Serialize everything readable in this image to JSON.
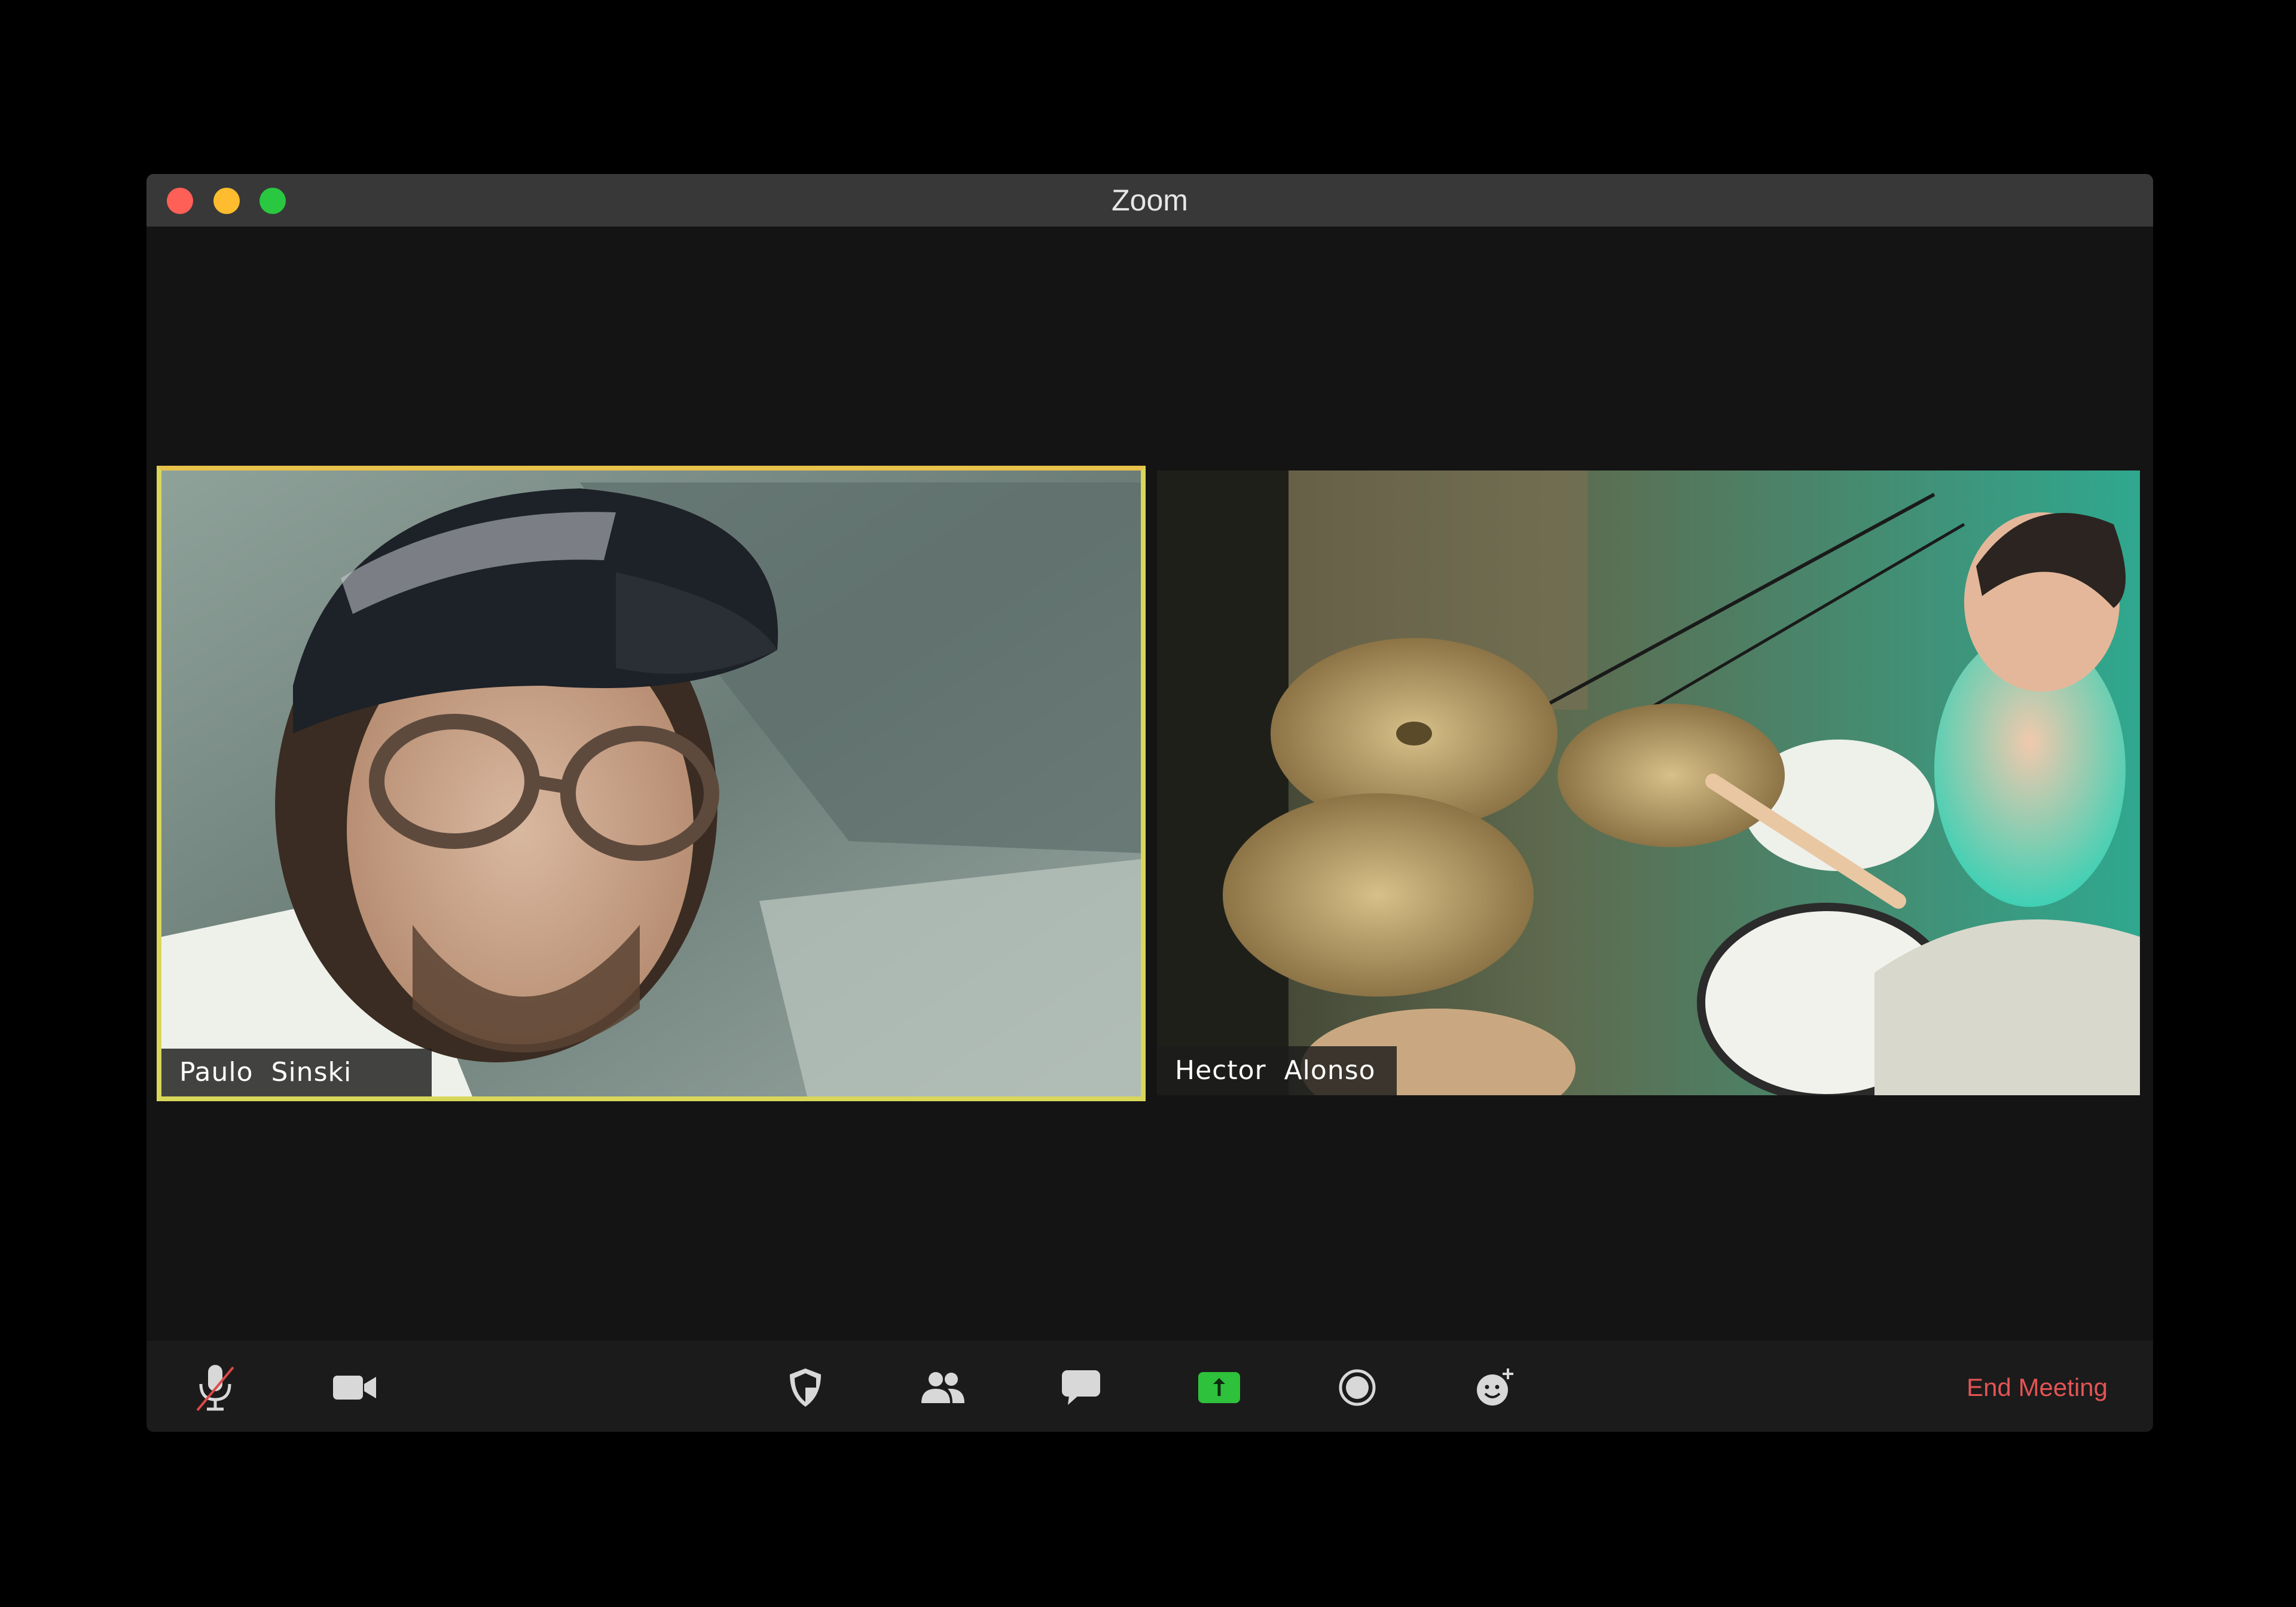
{
  "window": {
    "title": "Zoom"
  },
  "participants": [
    {
      "name": "Paulo  Sinski",
      "active_speaker": true
    },
    {
      "name": "Hector  Alonso",
      "active_speaker": false
    }
  ],
  "toolbar": {
    "buttons": [
      {
        "icon": "microphone-muted-icon",
        "label": ""
      },
      {
        "icon": "video-camera-icon",
        "label": ""
      },
      {
        "icon": "security-shield-icon",
        "label": ""
      },
      {
        "icon": "participants-icon",
        "label": ""
      },
      {
        "icon": "chat-icon",
        "label": ""
      },
      {
        "icon": "share-screen-icon",
        "label": ""
      },
      {
        "icon": "record-icon",
        "label": ""
      },
      {
        "icon": "reactions-icon",
        "label": ""
      }
    ],
    "end_meeting_label": "End Meeting"
  },
  "colors": {
    "background": "#000000",
    "window": "#141414",
    "titlebar": "#383838",
    "active_speaker_border": "#d8d75a",
    "share_green": "#2ec13b",
    "end_meeting_red": "#e35454"
  }
}
